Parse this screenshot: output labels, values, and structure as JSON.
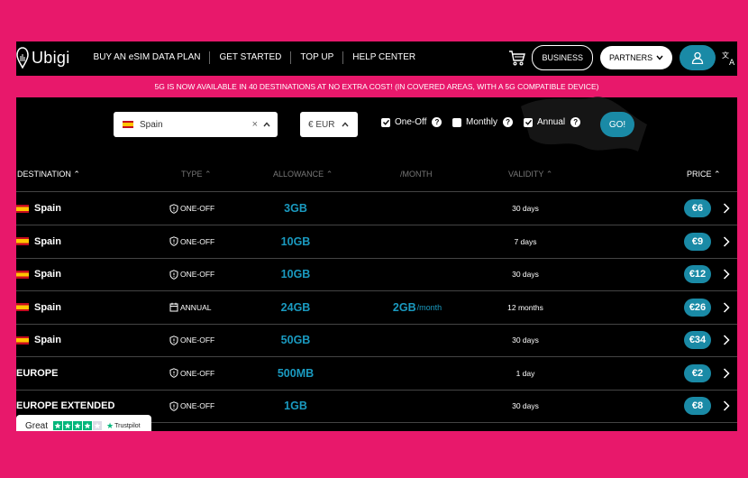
{
  "nav": {
    "logo_text": "Ubigi",
    "links": [
      "BUY AN eSIM DATA PLAN",
      "GET STARTED",
      "TOP UP",
      "HELP CENTER"
    ],
    "business_label": "BUSINESS",
    "partners_label": "PARTNERS"
  },
  "announcement": "5G IS NOW AVAILABLE IN 40 DESTINATIONS AT NO EXTRA COST! (IN COVERED AREAS, WITH A 5G COMPATIBLE DEVICE)",
  "filters": {
    "destination_value": "Spain",
    "clear_glyph": "×",
    "currency_value": "€ EUR",
    "options": [
      {
        "label": "One-Off",
        "checked": true
      },
      {
        "label": "Monthly",
        "checked": false
      },
      {
        "label": "Annual",
        "checked": true
      }
    ],
    "help_glyph": "?",
    "go_label": "GO!"
  },
  "table": {
    "headers": {
      "destination": "DESTINATION",
      "type": "TYPE",
      "allowance": "ALLOWANCE",
      "month": "/MONTH",
      "validity": "VALIDITY",
      "price": "PRICE"
    },
    "rows": [
      {
        "flag": true,
        "destination": "Spain",
        "type_icon": "shield-icon",
        "type": "ONE-OFF",
        "allowance": "3GB",
        "month": "",
        "month_unit": "",
        "validity": "30 days",
        "price": "€6"
      },
      {
        "flag": true,
        "destination": "Spain",
        "type_icon": "shield-icon",
        "type": "ONE-OFF",
        "allowance": "10GB",
        "month": "",
        "month_unit": "",
        "validity": "7 days",
        "price": "€9"
      },
      {
        "flag": true,
        "destination": "Spain",
        "type_icon": "shield-icon",
        "type": "ONE-OFF",
        "allowance": "10GB",
        "month": "",
        "month_unit": "",
        "validity": "30 days",
        "price": "€12"
      },
      {
        "flag": true,
        "destination": "Spain",
        "type_icon": "calendar-icon",
        "type": "ANNUAL",
        "allowance": "24GB",
        "month": "2GB",
        "month_unit": "/month",
        "validity": "12 months",
        "price": "€26"
      },
      {
        "flag": true,
        "destination": "Spain",
        "type_icon": "shield-icon",
        "type": "ONE-OFF",
        "allowance": "50GB",
        "month": "",
        "month_unit": "",
        "validity": "30 days",
        "price": "€34"
      },
      {
        "flag": false,
        "destination": "EUROPE",
        "type_icon": "shield-icon",
        "type": "ONE-OFF",
        "allowance": "500MB",
        "month": "",
        "month_unit": "",
        "validity": "1 day",
        "price": "€2"
      },
      {
        "flag": false,
        "destination": "EUROPE EXTENDED",
        "type_icon": "shield-icon",
        "type": "ONE-OFF",
        "allowance": "1GB",
        "month": "",
        "month_unit": "",
        "validity": "30 days",
        "price": "€8"
      }
    ]
  },
  "trustpilot": {
    "label": "Great",
    "brand": "Trustpilot",
    "stars_filled": 4,
    "stars_total": 5
  },
  "colors": {
    "page_background": "#e8186b",
    "accent": "#1a8aa6",
    "allowance_text": "#1a9ac0",
    "trustpilot_green": "#00b67a"
  }
}
